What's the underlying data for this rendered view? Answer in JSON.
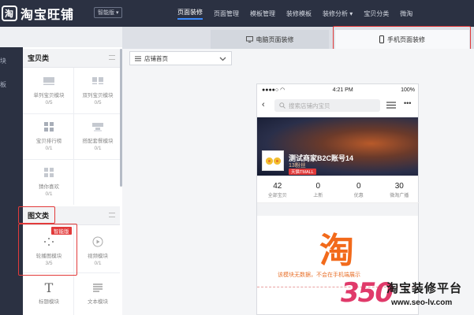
{
  "app": {
    "logo_text": "淘宝旺铺",
    "edition_label": "智能版 ▾"
  },
  "topnav": {
    "items": [
      "页面装修",
      "页面管理",
      "模板管理",
      "装修模板",
      "装修分析 ▾",
      "宝贝分类",
      "微淘"
    ]
  },
  "device_tabs": {
    "pc": "电脑页面装修",
    "mobile": "手机页面装修"
  },
  "rail": {
    "items": [
      "块",
      "板"
    ]
  },
  "sections": {
    "products": {
      "title": "宝贝类",
      "modules": [
        {
          "label": "单列宝贝模块",
          "count": "0/5"
        },
        {
          "label": "双列宝贝模块",
          "count": "0/5"
        },
        {
          "label": "宝贝排行榜",
          "count": "0/1"
        },
        {
          "label": "搭配套餐模块",
          "count": "0/1"
        },
        {
          "label": "猜你喜欢",
          "count": "0/1"
        }
      ]
    },
    "graphics": {
      "title": "图文类",
      "badge": "智能版",
      "modules": [
        {
          "label": "轮播图模块",
          "count": "3/5"
        },
        {
          "label": "视频模块",
          "count": "0/1"
        },
        {
          "label": "标题模块",
          "count": ""
        },
        {
          "label": "文本模块",
          "count": ""
        }
      ]
    }
  },
  "page_select": {
    "value": "店铺首页"
  },
  "phone": {
    "carrier": "●●●●○ ◠",
    "time": "4:21 PM",
    "battery": "100%",
    "search_placeholder": "搜索店铺内宝贝",
    "store_name": "测试商家B2C账号14",
    "fans": "13粉丝",
    "tmall_badge": "天猫TMALL",
    "stats": [
      {
        "value": "42",
        "label": "全部宝贝"
      },
      {
        "value": "0",
        "label": "上新"
      },
      {
        "value": "0",
        "label": "优惠"
      },
      {
        "value": "30",
        "label": "微淘广播"
      }
    ],
    "tao_char": "淘",
    "nodata_text": "该模块无数据，不会在手机端展示"
  },
  "watermark": {
    "number": "350",
    "brand": "淘宝装修平台",
    "url": "www.seo-lv.com"
  },
  "colors": {
    "topbar": "#2b3142",
    "highlight": "#e23a3a",
    "accent": "#3d8bfd",
    "tao": "#f26a1b"
  }
}
